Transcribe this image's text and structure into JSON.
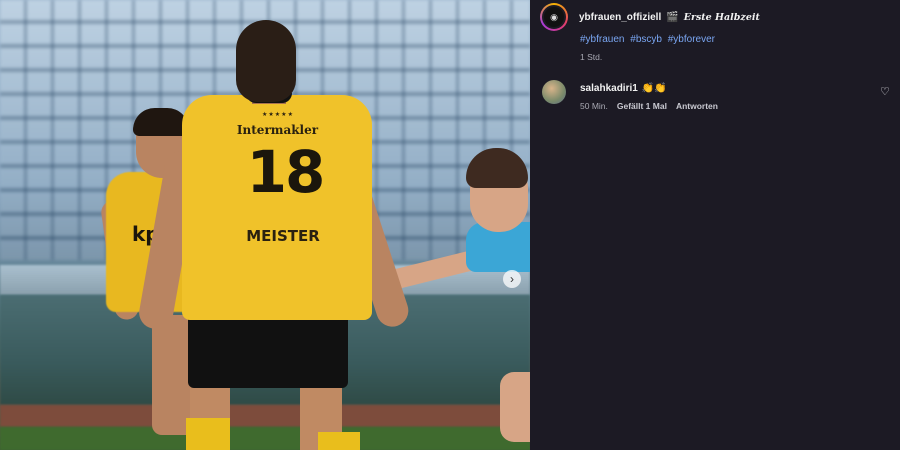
{
  "post": {
    "username": "ybfrauen_offiziell",
    "clapper_icon": "🎬",
    "caption": "Erste Halbzeit",
    "hashtags": [
      "#ybfrauen",
      "#bscyb",
      "#ybforever"
    ],
    "time": "1 Std."
  },
  "photo": {
    "jersey_stars": "★★★★★",
    "jersey_sponsor": "Intermakler",
    "jersey_number": "18",
    "jersey_name": "MEISTER",
    "sponsor_front": "kp",
    "next_icon": "›"
  },
  "comment": {
    "username": "salahkadiri1",
    "emoji": "👏👏",
    "time": "50 Min.",
    "likes": "Gefällt 1 Mal",
    "reply_label": "Antworten",
    "like_icon": "♡"
  },
  "colors": {
    "background": "#1c1a24",
    "hashtag": "#7aa6f2",
    "jersey": "#f0c22a"
  }
}
